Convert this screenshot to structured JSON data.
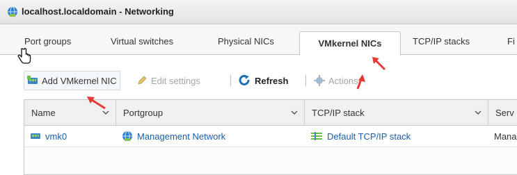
{
  "window": {
    "title": "localhost.localdomain - Networking"
  },
  "tabs": [
    {
      "label": "Port groups"
    },
    {
      "label": "Virtual switches"
    },
    {
      "label": "Physical NICs"
    },
    {
      "label": "VMkernel NICs",
      "active": true
    },
    {
      "label": "TCP/IP stacks"
    },
    {
      "label": "Fi"
    }
  ],
  "toolbar": {
    "add_label": "Add VMkernel NIC",
    "edit_label": "Edit settings",
    "refresh_label": "Refresh",
    "actions_label": "Actions"
  },
  "table": {
    "columns": [
      "Name",
      "Portgroup",
      "TCP/IP stack",
      "Serv"
    ],
    "rows": [
      {
        "name": "vmk0",
        "portgroup": "Management Network",
        "tcpip": "Default TCP/IP stack",
        "services": "Mana"
      }
    ]
  },
  "colors": {
    "accent": "#e53935",
    "link": "#1a5ea8",
    "active_tab_bg": "#ffffff"
  },
  "icons": [
    "globe-icon",
    "hand-pointer-icon",
    "nic-icon",
    "pencil-icon",
    "refresh-icon",
    "gear-icon",
    "sort-chevron-icon",
    "network-stack-icon",
    "annotation-arrow"
  ]
}
